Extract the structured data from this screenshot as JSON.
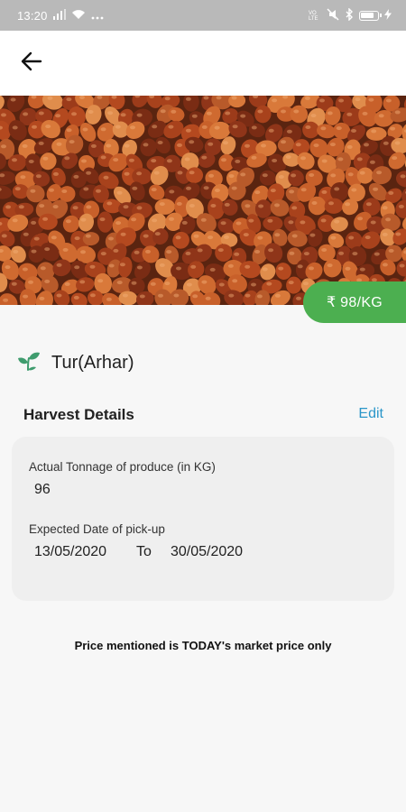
{
  "status_bar": {
    "time": "13:20",
    "left_icons": [
      "signal-icon",
      "wifi-icon",
      "more-dots-icon"
    ],
    "right_icons": [
      "volte-icon",
      "mute-icon",
      "bluetooth-icon",
      "battery-icon",
      "charging-icon"
    ],
    "battery_level": 0.8
  },
  "app_bar": {
    "back_icon": "arrow-back-icon"
  },
  "product": {
    "image_subject": "tur-arhar-seeds",
    "price": "₹ 98/KG",
    "crop_icon": "sprout-icon",
    "crop_name": "Tur(Arhar)"
  },
  "harvest": {
    "title": "Harvest Details",
    "edit_label": "Edit",
    "tonnage_label": "Actual Tonnage of produce (in KG)",
    "tonnage_value": "96",
    "pickup_label": "Expected Date of pick-up",
    "pickup_from": "13/05/2020",
    "pickup_sep": "To",
    "pickup_to": "30/05/2020"
  },
  "disclaimer": "Price mentioned is TODAY's market price only",
  "colors": {
    "status_bar": "#b9b9b9",
    "accent_green": "#4caf50",
    "link_blue": "#2a96c9",
    "card_bg": "#efefef"
  }
}
